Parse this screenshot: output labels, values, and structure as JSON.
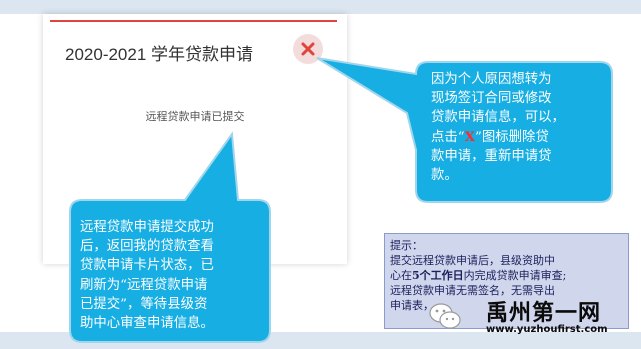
{
  "card": {
    "title": "2020-2021 学年贷款申请",
    "status": "远程贷款申请已提交"
  },
  "callout_right": {
    "lines": [
      "因为个人原因想转为",
      "现场签订合同或修改",
      "贷款申请信息，可以，"
    ],
    "line4_before": "点击“",
    "line4_x": "X",
    "line4_after": "”图标删除贷",
    "lines_after": [
      "款申请，重新申请贷",
      "款。"
    ]
  },
  "callout_left": {
    "lines": [
      "远程贷款申请提交成功",
      "后，返回我的贷款查看",
      "贷款申请卡片状态，已",
      "刷新为“远程贷款申请",
      "已提交”，等待县级资",
      "助中心审查申请信息。"
    ]
  },
  "tip": {
    "heading": "提示：",
    "line1": "提交远程贷款申请后，县级资助中",
    "line2_before": "心在",
    "line2_bold": "5个工作日",
    "line2_after": "内完成贷款申请审查;",
    "line3": "远程贷款申请无需签名，无需导出",
    "line4": "申请表，"
  },
  "watermark": {
    "title": "禹州第一网",
    "url": "www.yuzhoufirst.com"
  },
  "colors": {
    "callout_fill": "#17aee3",
    "card_accent": "#e0443a",
    "close_icon": "#e0443a"
  },
  "icons": {
    "close": "close-icon",
    "watermark_logo": "wechat-logo-icon"
  }
}
